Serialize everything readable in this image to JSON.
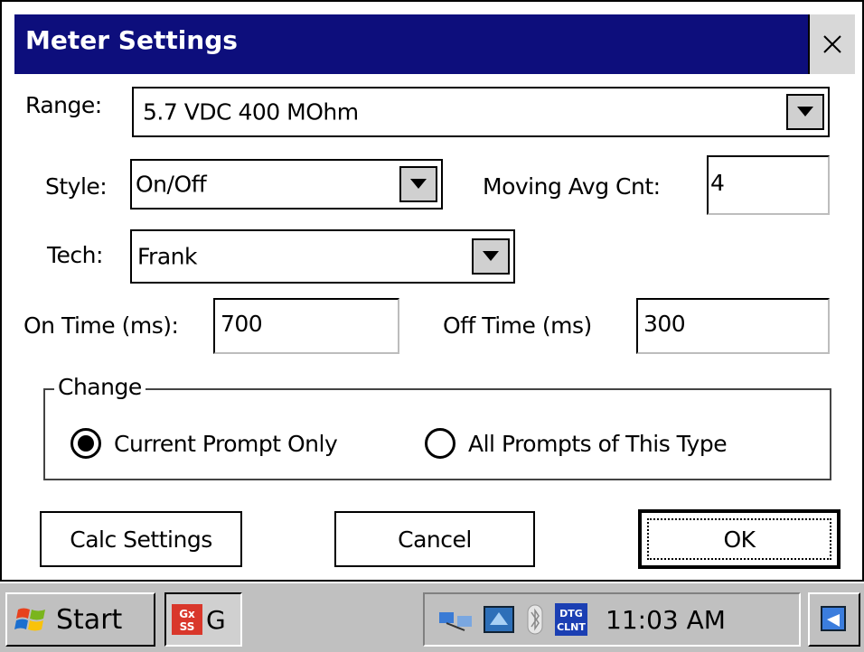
{
  "window": {
    "title": "Meter Settings"
  },
  "form": {
    "range": {
      "label": "Range:",
      "value": "5.7 VDC 400 MOhm"
    },
    "style": {
      "label": "Style:",
      "value": "On/Off"
    },
    "moving_avg": {
      "label": "Moving Avg Cnt:",
      "value": "4"
    },
    "tech": {
      "label": "Tech:",
      "value": "Frank"
    },
    "on_time": {
      "label": "On Time (ms):",
      "value": "700"
    },
    "off_time": {
      "label": "Off Time (ms)",
      "value": "300"
    }
  },
  "change": {
    "label": "Change",
    "options": [
      {
        "label": "Current Prompt Only",
        "selected": true
      },
      {
        "label": "All Prompts of This Type",
        "selected": false
      }
    ]
  },
  "buttons": {
    "calc": "Calc Settings",
    "cancel": "Cancel",
    "ok": "OK"
  },
  "taskbar": {
    "start": "Start",
    "task_label": "G",
    "clock": "11:03 AM"
  },
  "colors": {
    "titlebar": "#0d0e7c",
    "taskbar": "#c0c0c0"
  }
}
